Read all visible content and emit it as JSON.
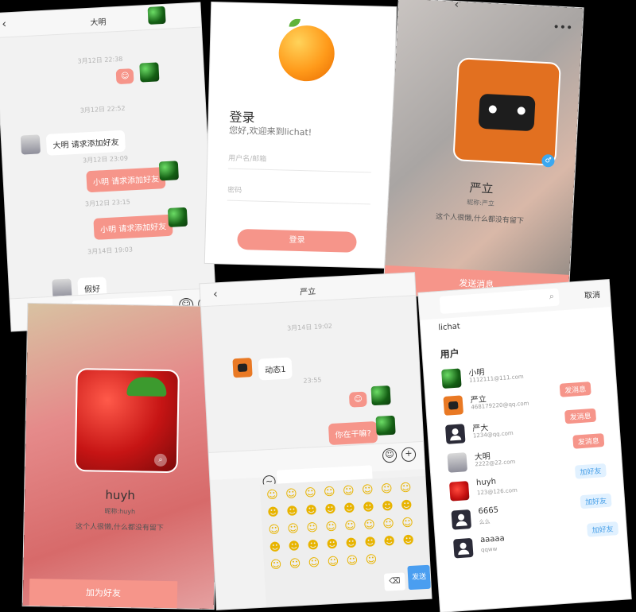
{
  "chat1": {
    "title": "大明",
    "messages": [
      {
        "kind": "time",
        "text": "3月12日 22:38"
      },
      {
        "kind": "right-emoji",
        "text": "☺"
      },
      {
        "kind": "time",
        "text": "3月12日 22:52"
      },
      {
        "kind": "left",
        "text": "大明 请求添加好友"
      },
      {
        "kind": "time",
        "text": "3月12日 23:09"
      },
      {
        "kind": "right",
        "text": "小明 请求添加好友"
      },
      {
        "kind": "time",
        "text": "3月12日 23:15"
      },
      {
        "kind": "right",
        "text": "小明 请求添加好友"
      },
      {
        "kind": "time",
        "text": "3月14日 19:03"
      },
      {
        "kind": "left",
        "text": "假好"
      }
    ]
  },
  "login": {
    "title": "登录",
    "subtitle": "您好,欢迎来到lichat!",
    "username_placeholder": "用户名/邮箱",
    "password_placeholder": "密码",
    "button": "登录"
  },
  "profile1": {
    "name": "严立",
    "nickname": "昵称:严立",
    "bio": "这个人很懒,什么都没有留下",
    "action": "发送消息"
  },
  "profile2": {
    "name": "huyh",
    "nickname": "昵称:huyh",
    "bio": "这个人很懒,什么都没有留下",
    "action": "加为好友"
  },
  "chat2": {
    "title": "严立",
    "messages": [
      {
        "kind": "time",
        "text": "3月14日 19:02"
      },
      {
        "kind": "left",
        "text": "动态1"
      },
      {
        "kind": "time",
        "text": "23:55"
      },
      {
        "kind": "right-emoji",
        "text": "☺"
      },
      {
        "kind": "right",
        "text": "你在干嘛?"
      }
    ],
    "send_label": "发送"
  },
  "search": {
    "query": "lichat",
    "cancel": "取消",
    "section": "用户",
    "users": [
      {
        "name": "小明",
        "email": "1112111@111.com",
        "action": "发消息",
        "type": "send",
        "avatar": "green"
      },
      {
        "name": "严立",
        "email": "468179220@qq.com",
        "action": "发消息",
        "type": "send",
        "avatar": "robot"
      },
      {
        "name": "严大",
        "email": "1234@qq.com",
        "action": "发消息",
        "type": "send",
        "avatar": "user"
      },
      {
        "name": "大明",
        "email": "2222@22.com",
        "action": "加好友",
        "type": "add",
        "avatar": "man"
      },
      {
        "name": "huyh",
        "email": "123@126.com",
        "action": "加好友",
        "type": "add",
        "avatar": "straw"
      },
      {
        "name": "6665",
        "email": "么么",
        "action": "",
        "type": "none",
        "avatar": "user"
      },
      {
        "name": "aaaaa",
        "email": "qqww",
        "action": "加好友",
        "type": "add",
        "avatar": "user"
      }
    ]
  },
  "emoji_icons": [
    "smile-face-icon",
    "grinning-face-icon",
    "laughing-face-icon",
    "wink-face-icon"
  ]
}
